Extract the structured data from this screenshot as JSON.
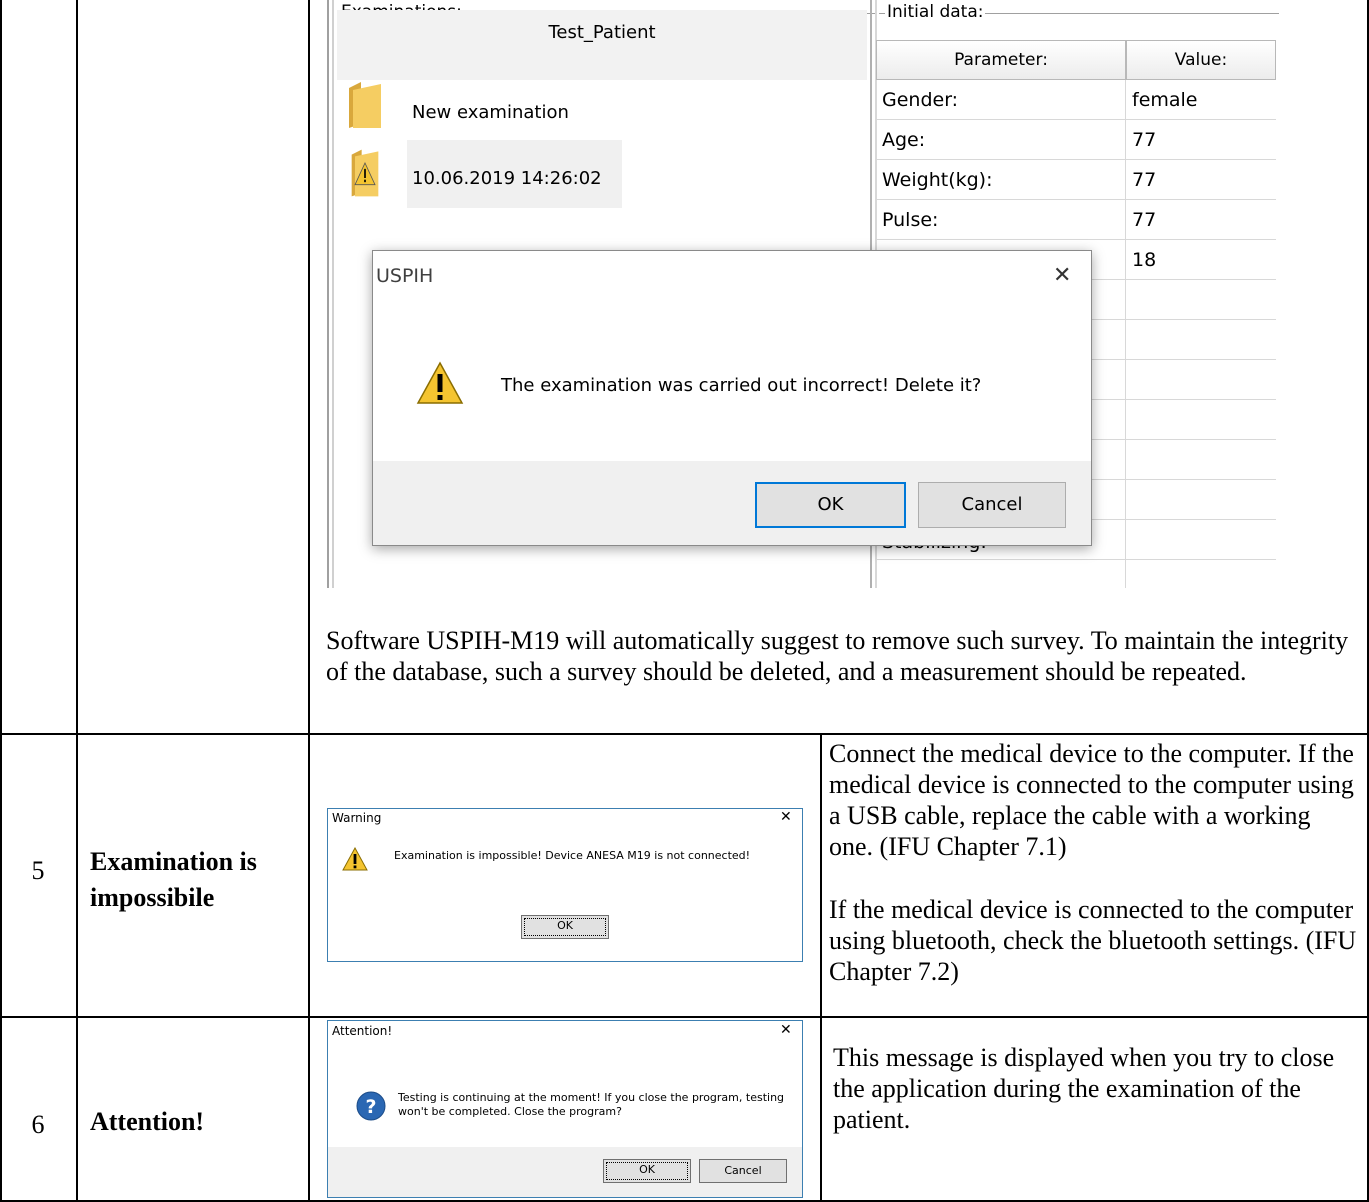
{
  "rows": [
    {
      "number": "",
      "name": "",
      "screenshot": {
        "examinations_label": "Examinations:",
        "patient": "Test_Patient",
        "items": [
          "New examination",
          "10.06.2019 14:26:02"
        ],
        "initial_data_label": "Initial data:",
        "columns": [
          "Parameter:",
          "Value:"
        ],
        "parameters": [
          {
            "name": "Gender:",
            "value": "female"
          },
          {
            "name": "Age:",
            "value": "77"
          },
          {
            "name": "Weight(kg):",
            "value": "77"
          },
          {
            "name": "Pulse:",
            "value": "77"
          },
          {
            "name": "",
            "value": "18"
          }
        ],
        "partial_label": "Stabilizing:",
        "dialog": {
          "title": "USPIH",
          "close": "✕",
          "message": "The examination was carried out incorrect! Delete it?",
          "ok": "OK",
          "cancel": "Cancel"
        }
      },
      "text": "Software USPIH-M19 will automatically suggest to remove such survey. To maintain the integrity of the database, such a survey should be deleted, and a measurement should be repeated."
    },
    {
      "number": "5",
      "name": "Examination is impossibile",
      "dialog": {
        "title": "Warning",
        "close": "✕",
        "message": "Examination is impossible! Device ANESA M19 is not connected!",
        "ok": "OK"
      },
      "text_1": "Connect the medical device to the computer. If the medical device is connected to the computer using a USB cable, replace the cable with a working one. (IFU Chapter 7.1)",
      "text_2": "If the medical device is connected to the computer using bluetooth, check the bluetooth settings. (IFU Chapter 7.2)"
    },
    {
      "number": "6",
      "name": "Attention!",
      "dialog": {
        "title": "Attention!",
        "close": "✕",
        "message": "Testing is continuing at the moment! If you close the program, testing won't be completed. Close the program?",
        "ok": "OK",
        "cancel": "Cancel"
      },
      "text": "This message is displayed when you try to close the application during the examination of the patient."
    }
  ],
  "colors": {
    "border": "#000000",
    "dialog_footer": "#f0f0f0",
    "button_focus": "#0078d7",
    "warning_icon": "#f4c430",
    "question_icon": "#2a67b3"
  }
}
